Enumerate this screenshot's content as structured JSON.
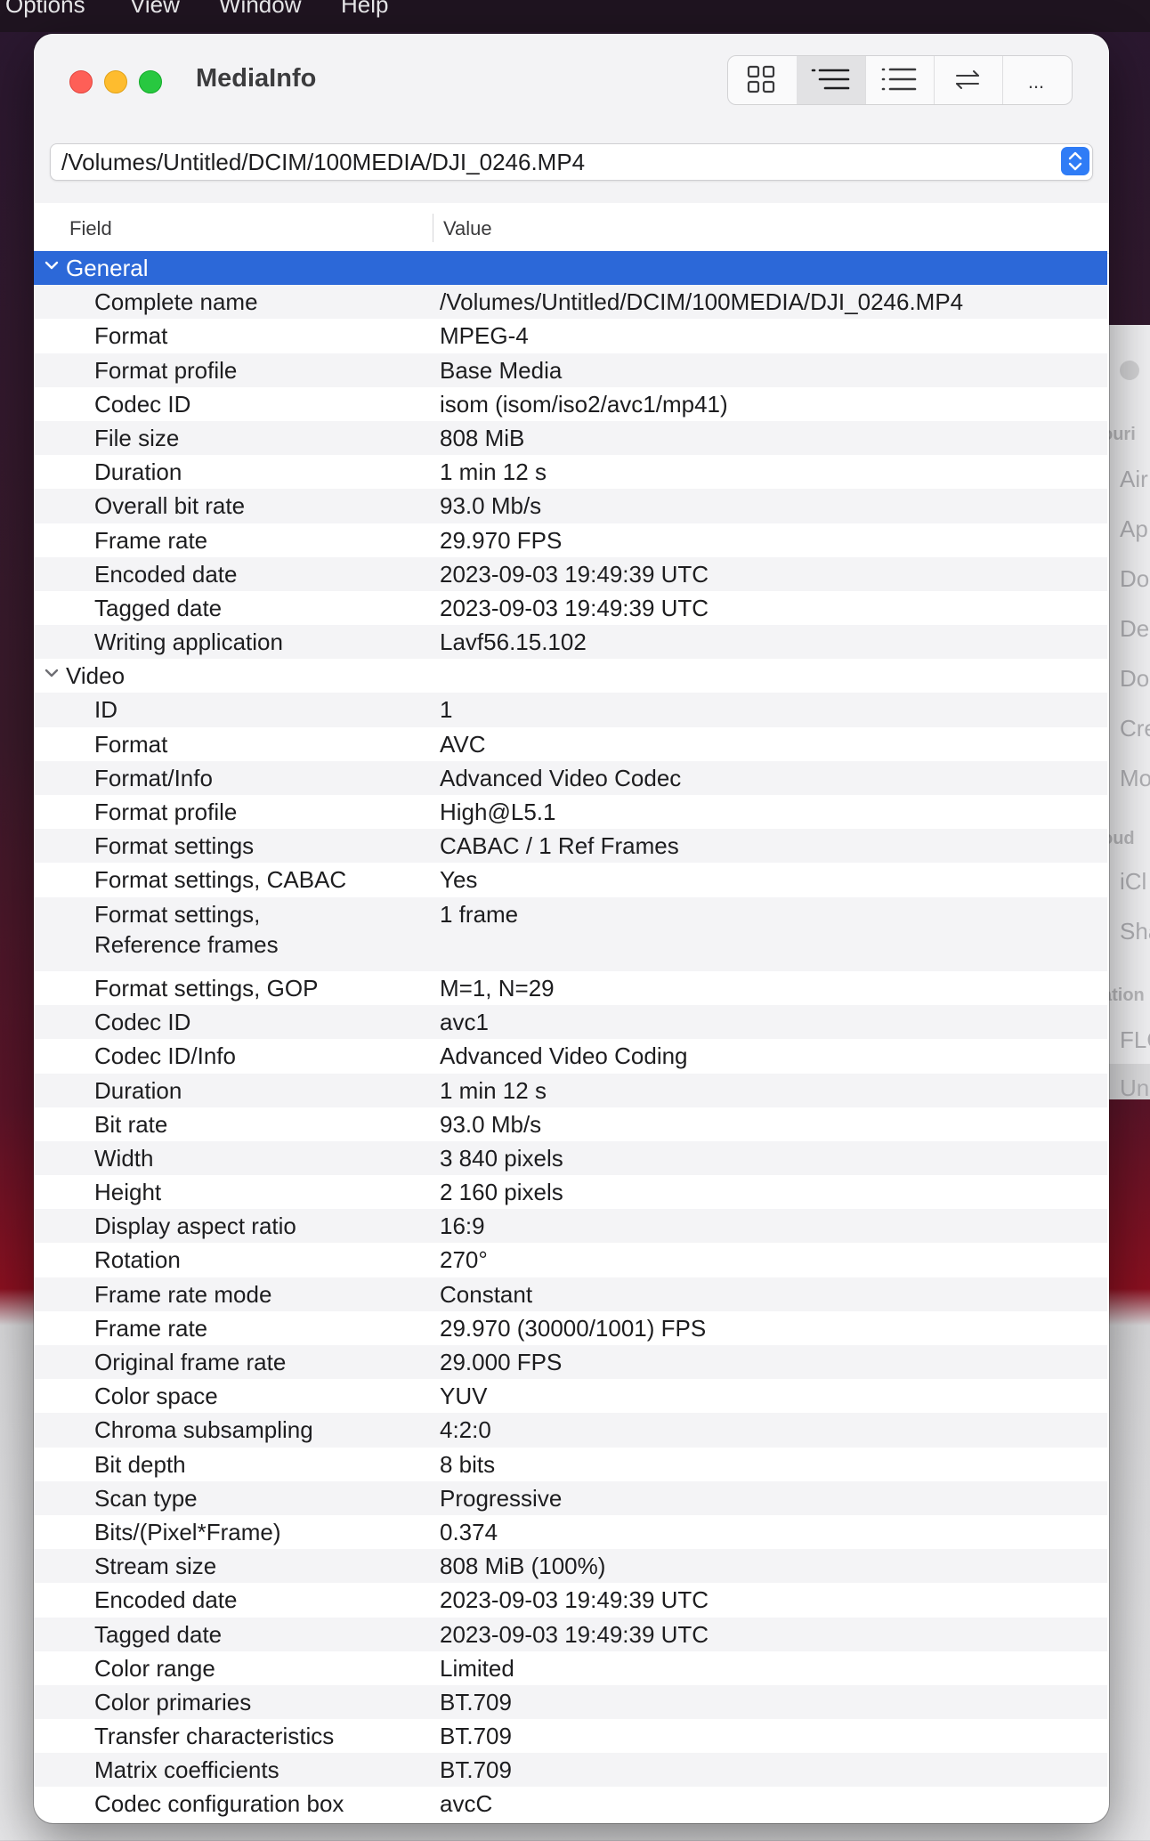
{
  "menubar": {
    "items": [
      "Options",
      "View",
      "Window",
      "Help"
    ]
  },
  "background_window": {
    "items": [
      "Air",
      "Ap",
      "Do",
      "De",
      "Do",
      "Cre",
      "Mo",
      "iCl",
      "Sha",
      "FLO",
      "Un"
    ],
    "headers": [
      "ouri",
      "oud",
      "ation"
    ]
  },
  "window": {
    "title": "MediaInfo",
    "toolbar": [
      "grid-view-icon",
      "tree-view-icon",
      "list-view-icon",
      "swap-icon",
      "more-icon"
    ],
    "toolbar_more_label": "...",
    "path": "/Volumes/Untitled/DCIM/100MEDIA/DJI_0246.MP4",
    "accent": "#2c68d8"
  },
  "table": {
    "header_field": "Field",
    "header_value": "Value",
    "sections": [
      {
        "name": "General",
        "rows": [
          {
            "field": "Complete name",
            "value": "/Volumes/Untitled/DCIM/100MEDIA/DJI_0246.MP4"
          },
          {
            "field": "Format",
            "value": "MPEG-4"
          },
          {
            "field": "Format profile",
            "value": "Base Media"
          },
          {
            "field": "Codec ID",
            "value": "isom (isom/iso2/avc1/mp41)"
          },
          {
            "field": "File size",
            "value": "808 MiB"
          },
          {
            "field": "Duration",
            "value": "1 min 12 s"
          },
          {
            "field": "Overall bit rate",
            "value": "93.0 Mb/s"
          },
          {
            "field": "Frame rate",
            "value": "29.970 FPS"
          },
          {
            "field": "Encoded date",
            "value": "2023-09-03 19:49:39 UTC"
          },
          {
            "field": "Tagged date",
            "value": "2023-09-03 19:49:39 UTC"
          },
          {
            "field": "Writing application",
            "value": "Lavf56.15.102"
          }
        ]
      },
      {
        "name": "Video",
        "rows": [
          {
            "field": "ID",
            "value": "1"
          },
          {
            "field": "Format",
            "value": "AVC"
          },
          {
            "field": "Format/Info",
            "value": "Advanced Video Codec"
          },
          {
            "field": "Format profile",
            "value": "High@L5.1"
          },
          {
            "field": "Format settings",
            "value": "CABAC / 1 Ref Frames"
          },
          {
            "field": "Format settings, CABAC",
            "value": "Yes"
          },
          {
            "field": "Format settings,",
            "field2": "Reference frames",
            "value": "1 frame"
          },
          {
            "field": "Format settings, GOP",
            "value": "M=1, N=29"
          },
          {
            "field": "Codec ID",
            "value": "avc1"
          },
          {
            "field": "Codec ID/Info",
            "value": "Advanced Video Coding"
          },
          {
            "field": "Duration",
            "value": "1 min 12 s"
          },
          {
            "field": "Bit rate",
            "value": "93.0 Mb/s"
          },
          {
            "field": "Width",
            "value": "3 840 pixels"
          },
          {
            "field": "Height",
            "value": "2 160 pixels"
          },
          {
            "field": "Display aspect ratio",
            "value": "16:9"
          },
          {
            "field": "Rotation",
            "value": "270°"
          },
          {
            "field": "Frame rate mode",
            "value": "Constant"
          },
          {
            "field": "Frame rate",
            "value": "29.970 (30000/1001) FPS"
          },
          {
            "field": "Original frame rate",
            "value": "29.000 FPS"
          },
          {
            "field": "Color space",
            "value": "YUV"
          },
          {
            "field": "Chroma subsampling",
            "value": "4:2:0"
          },
          {
            "field": "Bit depth",
            "value": "8 bits"
          },
          {
            "field": "Scan type",
            "value": "Progressive"
          },
          {
            "field": "Bits/(Pixel*Frame)",
            "value": "0.374"
          },
          {
            "field": "Stream size",
            "value": "808 MiB (100%)"
          },
          {
            "field": "Encoded date",
            "value": "2023-09-03 19:49:39 UTC"
          },
          {
            "field": "Tagged date",
            "value": "2023-09-03 19:49:39 UTC"
          },
          {
            "field": "Color range",
            "value": "Limited"
          },
          {
            "field": "Color primaries",
            "value": "BT.709"
          },
          {
            "field": "Transfer characteristics",
            "value": "BT.709"
          },
          {
            "field": "Matrix coefficients",
            "value": "BT.709"
          },
          {
            "field": "Codec configuration box",
            "value": "avcC"
          }
        ]
      }
    ]
  }
}
